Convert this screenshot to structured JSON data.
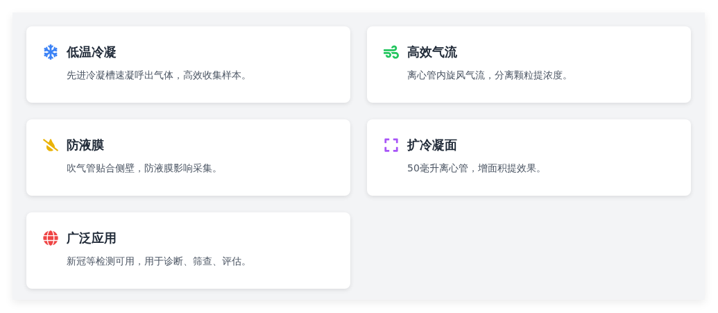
{
  "features": [
    {
      "color": "#3b82f6",
      "title": "低温冷凝",
      "description": "先进冷凝槽速凝呼出气体，高效收集样本。"
    },
    {
      "color": "#22c55e",
      "title": "高效气流",
      "description": "离心管内旋风气流，分离颗粒提浓度。"
    },
    {
      "color": "#eab308",
      "title": "防液膜",
      "description": "吹气管贴合侧壁，防液膜影响采集。"
    },
    {
      "color": "#a855f7",
      "title": "扩冷凝面",
      "description": "50毫升离心管，增面积提效果。"
    },
    {
      "color": "#ef4444",
      "title": "广泛应用",
      "description": "新冠等检测可用，用于诊断、筛查、评估。"
    }
  ]
}
